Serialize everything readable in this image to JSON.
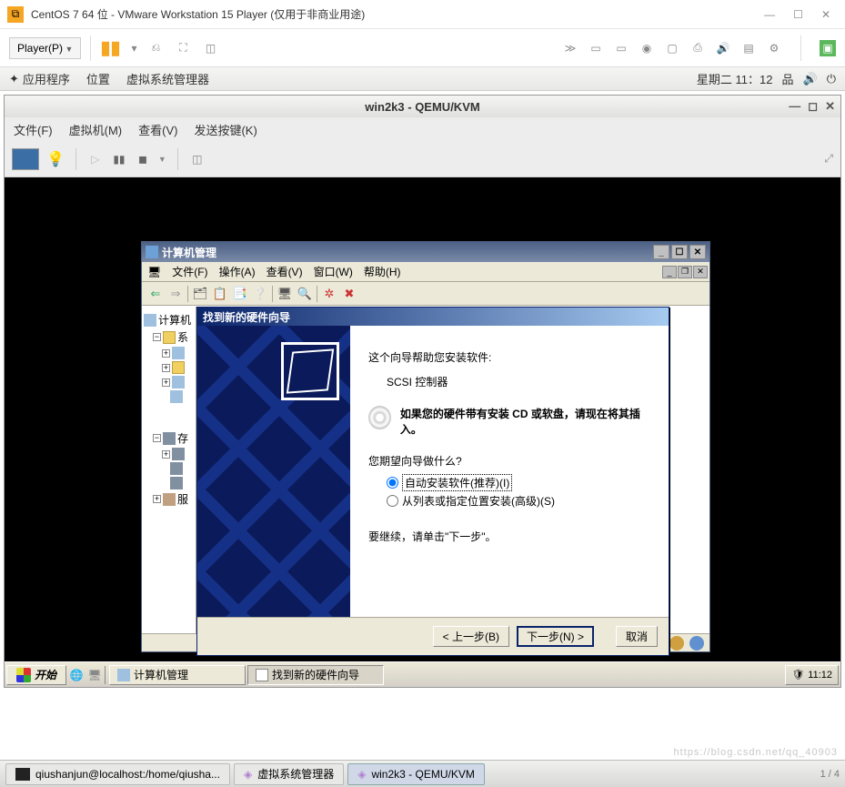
{
  "vmware": {
    "title": "CentOS 7 64 位 - VMware Workstation 15 Player (仅用于非商业用途)",
    "player_menu": "Player(P)",
    "ctrl_min": "—",
    "ctrl_max": "☐",
    "ctrl_close": "✕"
  },
  "gnome": {
    "apps": "应用程序",
    "places": "位置",
    "virtman": "虚拟系统管理器",
    "clock": "星期二 11：12"
  },
  "qemu": {
    "title": "win2k3 - QEMU/KVM",
    "menu_file": "文件(F)",
    "menu_vm": "虚拟机(M)",
    "menu_view": "查看(V)",
    "menu_keys": "发送按键(K)"
  },
  "mmc": {
    "title": "计算机管理",
    "menu_file": "文件(F)",
    "menu_action": "操作(A)",
    "menu_view": "查看(V)",
    "menu_window": "窗口(W)",
    "menu_help": "帮助(H)",
    "tree_root": "计算机",
    "tree_sys": "系",
    "tree_store": "存",
    "tree_svc": "服"
  },
  "wizard": {
    "title": "找到新的硬件向导",
    "intro": "这个向导帮助您安装软件:",
    "device": "SCSI 控制器",
    "cd_msg": "如果您的硬件带有安装 CD 或软盘，请现在将其插入。",
    "question": "您期望向导做什么?",
    "opt_auto": "自动安装软件(推荐)(I)",
    "opt_list": "从列表或指定位置安装(高级)(S)",
    "proceed": "要继续，请单击\"下一步\"。",
    "back": "< 上一步(B)",
    "next": "下一步(N) >",
    "cancel": "取消"
  },
  "wintb": {
    "start": "开始",
    "task_mmc": "计算机管理",
    "task_wiz": "找到新的硬件向导",
    "clock": "11:12"
  },
  "gbottom": {
    "task1": "qiushanjun@localhost:/home/qiusha...",
    "task2": "虚拟系统管理器",
    "task3": "win2k3 - QEMU/KVM",
    "pager": "1 / 4"
  },
  "watermark": "https://blog.csdn.net/qq_40903"
}
